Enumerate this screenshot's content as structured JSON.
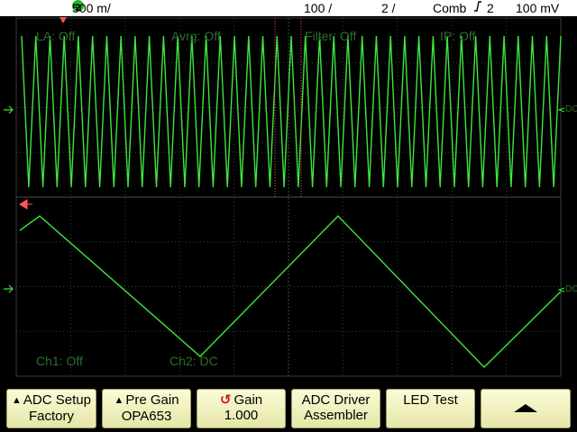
{
  "status": {
    "channel_number": "2",
    "channel_scale": "500 m/",
    "timebase": "100 /",
    "delay": "2 /",
    "trigger_mode": "Comb",
    "trigger_channel": "2",
    "trigger_level": "100 mV"
  },
  "overlays": {
    "la": "LA: Off",
    "avrg": "Avrg: Off",
    "filter": "Filter: Off",
    "ip": "IP: Off",
    "ch1": "Ch1: Off",
    "ch2": "Ch2: DC",
    "dc_upper": "DC",
    "dc_lower": "DC"
  },
  "softkeys": [
    {
      "line1": "ADC Setup",
      "line2": "Factory",
      "prefix": "triangle"
    },
    {
      "line1": "Pre Gain",
      "line2": "OPA653",
      "prefix": "triangle"
    },
    {
      "line1": "Gain",
      "line2": "1.000",
      "prefix": "knob"
    },
    {
      "line1": "ADC Driver",
      "line2": "Assembler",
      "prefix": ""
    },
    {
      "line1": "LED Test",
      "line2": "",
      "prefix": ""
    },
    {
      "line1": "",
      "line2": "",
      "prefix": "up-arrow"
    }
  ],
  "colors": {
    "trace": "#3ee63e",
    "overlay_text": "#2b6e2b",
    "grid": "#3a3a3a",
    "marker": "#ff5555",
    "badge": "#27b427"
  },
  "icons": {
    "channel_badge": "channel-2-badge",
    "trigger_slope": "trigger-slope-icon",
    "gain_knob": "rotary-knob-icon",
    "up_arrow": "up-arrow-icon",
    "trigger_marker": "trigger-position-marker-icon",
    "level_marker": "trigger-level-arrow-icon"
  }
}
